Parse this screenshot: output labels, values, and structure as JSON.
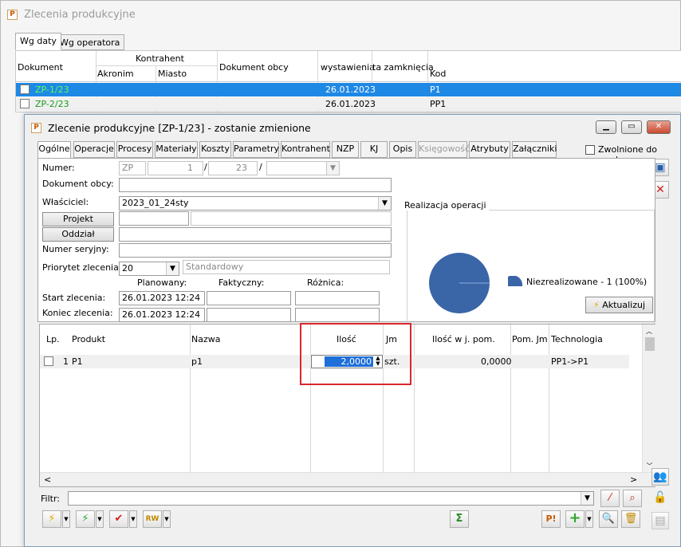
{
  "outer": {
    "title": "Zlecenia produkcyjne",
    "tabs": [
      "Wg daty",
      "Wg operatora"
    ],
    "columns": {
      "dokument": "Dokument",
      "kontrahent": "Kontrahent",
      "akronim": "Akronim",
      "miasto": "Miasto",
      "dokument_obcy": "Dokument obcy",
      "wystawienia": "wystawienia",
      "zamkniecia": "ta zamknięcia",
      "kod": "Kod"
    },
    "rows": [
      {
        "dokument": "ZP-1/23",
        "date": "26.01.2023",
        "kod": "P1"
      },
      {
        "dokument": "ZP-2/23",
        "date": "26.01.2023",
        "kod": "PP1"
      }
    ]
  },
  "dialog": {
    "title": "Zlecenie produkcyjne  [ZP-1/23] - zostanie zmienione",
    "tabs": [
      "Ogólne",
      "Operacje",
      "Procesy",
      "Materiały",
      "Koszty",
      "Parametry",
      "Kontrahent",
      "NZP",
      "KJ",
      "Opis",
      "Księgowość",
      "Atrybuty",
      "Załączniki"
    ],
    "zwolnione_label": "Zwolnione do prod.",
    "form": {
      "numer_label": "Numer:",
      "numer_prefix": "ZP",
      "numer_no": "1",
      "numer_month": "23",
      "slash": "/",
      "dokument_obcy_label": "Dokument obcy:",
      "wlasciciel_label": "Właściciel:",
      "wlasciciel_value": "2023_01_24sty",
      "projekt_button": "Projekt",
      "oddzial_button": "Oddział",
      "numer_seryjny_label": "Numer seryjny:",
      "priorytet_label": "Priorytet zlecenia:",
      "priorytet_value": "20",
      "priorytet_name": "Standardowy",
      "planowany_label": "Planowany:",
      "faktyczny_label": "Faktyczny:",
      "roznica_label": "Różnica:",
      "start_label": "Start zlecenia:",
      "start_value": "26.01.2023 12:24",
      "koniec_label": "Koniec zlecenia:",
      "koniec_value": "26.01.2023 12:24"
    },
    "realizacja": {
      "title": "Realizacja operacji",
      "legend": "Niezrealizowane - 1 (100%)",
      "percent": 100,
      "color": "#3a66a8",
      "aktualizuj": "Aktualizuj"
    },
    "grid": {
      "columns": {
        "lp": "Lp.",
        "produkt": "Produkt",
        "nazwa": "Nazwa",
        "ilosc": "Ilość",
        "jm": "Jm",
        "ilosc_pom": "Ilość w j. pom.",
        "pom_jm": "Pom. Jm",
        "technologia": "Technologia"
      },
      "rows": [
        {
          "lp": "1",
          "produkt": "P1",
          "nazwa": "p1",
          "ilosc": "2,0000",
          "jm": "szt.",
          "ilosc_pom": "0,0000",
          "pom_jm": "",
          "technologia": "PP1->P1"
        }
      ]
    },
    "filter_label": "Filtr:",
    "toolbar_rw": "RW"
  }
}
